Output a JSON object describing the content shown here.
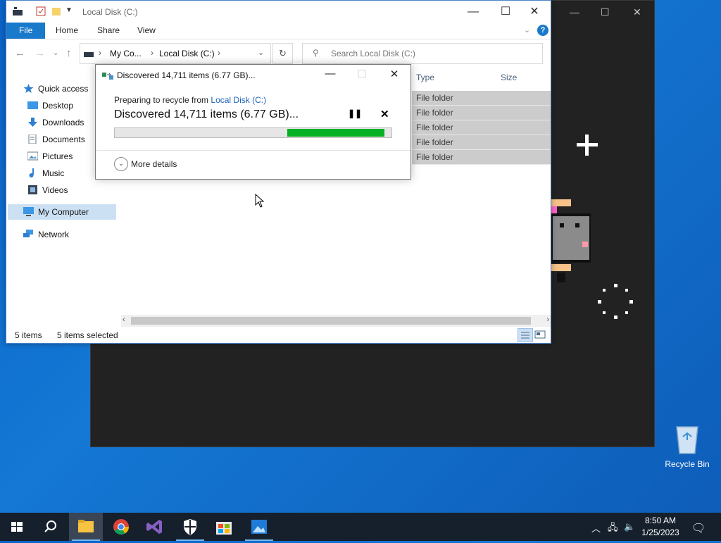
{
  "background_window": {
    "min_glyph": "—",
    "max_glyph": "☐",
    "close_glyph": "✕"
  },
  "desktop": {
    "recycle_bin_label": "Recycle Bin"
  },
  "explorer": {
    "title": "Local Disk (C:)",
    "window_controls": {
      "minimize": "—",
      "maximize": "☐",
      "close": "✕"
    },
    "ribbon": {
      "tabs": [
        "File",
        "Home",
        "Share",
        "View"
      ]
    },
    "address": {
      "crumbs": [
        "My Co...",
        "Local Disk (C:)"
      ],
      "search_placeholder": "Search Local Disk (C:)"
    },
    "nav": {
      "quick_access": "Quick access",
      "items": [
        "Desktop",
        "Downloads",
        "Documents",
        "Pictures",
        "Music",
        "Videos"
      ],
      "my_computer": "My Computer",
      "network": "Network"
    },
    "columns": {
      "type": "Type",
      "size": "Size"
    },
    "rows": [
      "File folder",
      "File folder",
      "File folder",
      "File folder",
      "File folder"
    ],
    "status": {
      "count": "5 items",
      "selected": "5 items selected"
    }
  },
  "dialog": {
    "title": "Discovered 14,711 items (6.77 GB)...",
    "preparing_text": "Preparing to recycle from ",
    "preparing_link": "Local Disk (C:)",
    "discovered": "Discovered 14,711 items (6.77 GB)...",
    "progress_fraction": 0.35,
    "more_details": "More details",
    "pause_glyph": "❚❚",
    "cancel_glyph": "✕"
  },
  "taskbar": {
    "time": "8:50 AM",
    "date": "1/25/2023"
  }
}
